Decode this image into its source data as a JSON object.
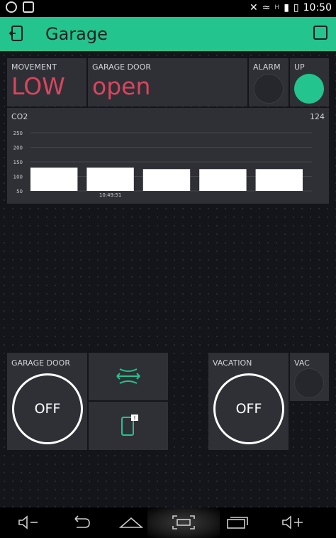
{
  "status_bar": {
    "time": "10:50",
    "network": "H"
  },
  "app": {
    "title": "Garage"
  },
  "widgets": {
    "movement": {
      "label": "MOVEMENT",
      "value": "LOW"
    },
    "garage_door_state": {
      "label": "GARAGE DOOR",
      "value": "open"
    },
    "alarm": {
      "label": "ALARM",
      "on": false
    },
    "up": {
      "label": "UP",
      "on": true
    },
    "co2": {
      "label": "CO2",
      "current": "124"
    },
    "garage_door_button": {
      "label": "GARAGE DOOR",
      "button": "OFF"
    },
    "vacation_button": {
      "label": "VACATION",
      "button": "OFF"
    },
    "vac": {
      "label": "VAC",
      "on": false
    }
  },
  "colors": {
    "accent": "#23c48e",
    "value_red": "#d9455f",
    "widget_bg": "#2f3035"
  },
  "chart_data": {
    "type": "bar",
    "title": "CO2",
    "yticks": [
      "250",
      "200",
      "150",
      "100",
      "50"
    ],
    "ylim": [
      50,
      250
    ],
    "xticks": [
      "10:49:51"
    ],
    "values": [
      130,
      130,
      125,
      125,
      125
    ],
    "series_color": "#ffffff",
    "grid": true
  }
}
